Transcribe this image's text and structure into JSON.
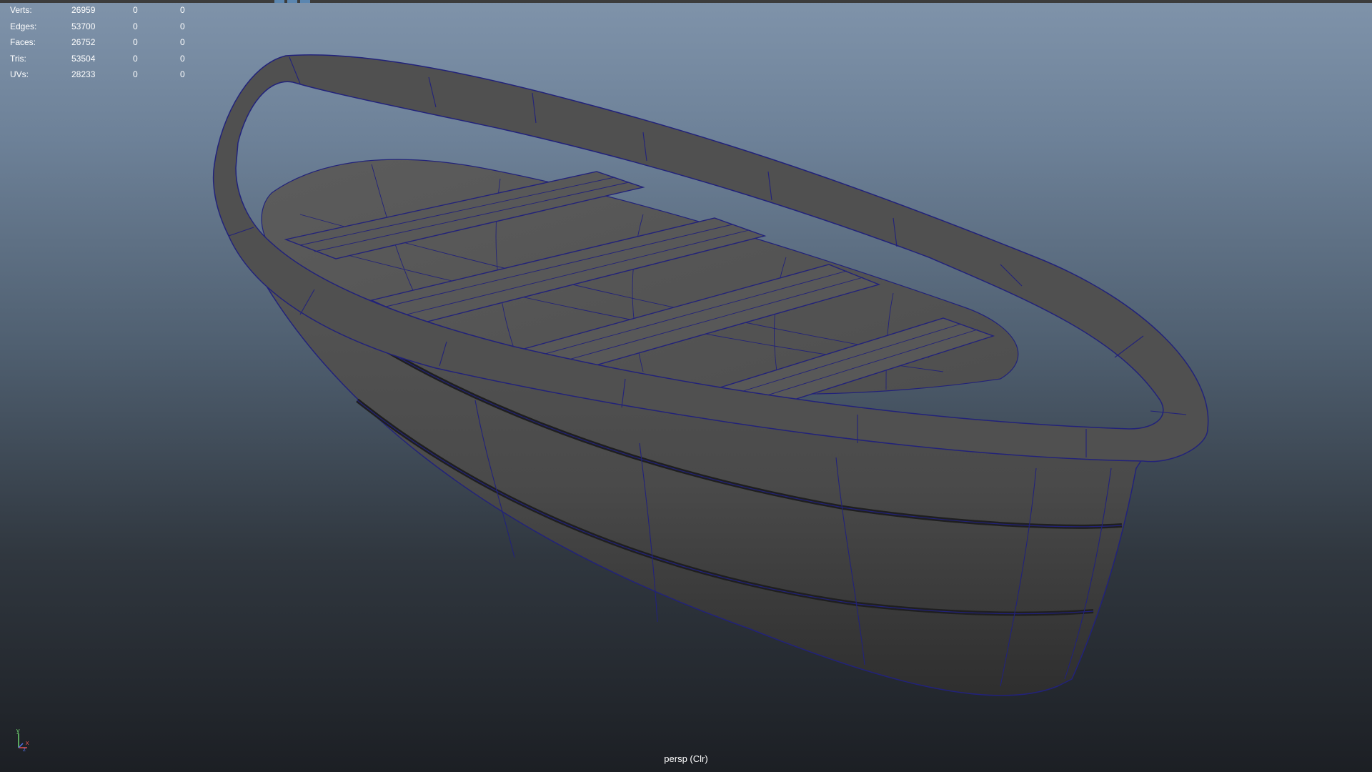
{
  "hud": {
    "rows": [
      {
        "label": "Verts:",
        "total": "26959",
        "selected": "0",
        "highlighted": "0"
      },
      {
        "label": "Edges:",
        "total": "53700",
        "selected": "0",
        "highlighted": "0"
      },
      {
        "label": "Faces:",
        "total": "26752",
        "selected": "0",
        "highlighted": "0"
      },
      {
        "label": "Tris:",
        "total": "53504",
        "selected": "0",
        "highlighted": "0"
      },
      {
        "label": "UVs:",
        "total": "28233",
        "selected": "0",
        "highlighted": "0"
      }
    ]
  },
  "viewport": {
    "camera_label": "persp (Clr)",
    "background_top": "#7f93aa",
    "background_bottom": "#1c1f24",
    "wireframe_color": "#22227a",
    "model_shade": "#555555"
  },
  "axis_gizmo": {
    "x": "x",
    "y": "y",
    "z": "z"
  }
}
